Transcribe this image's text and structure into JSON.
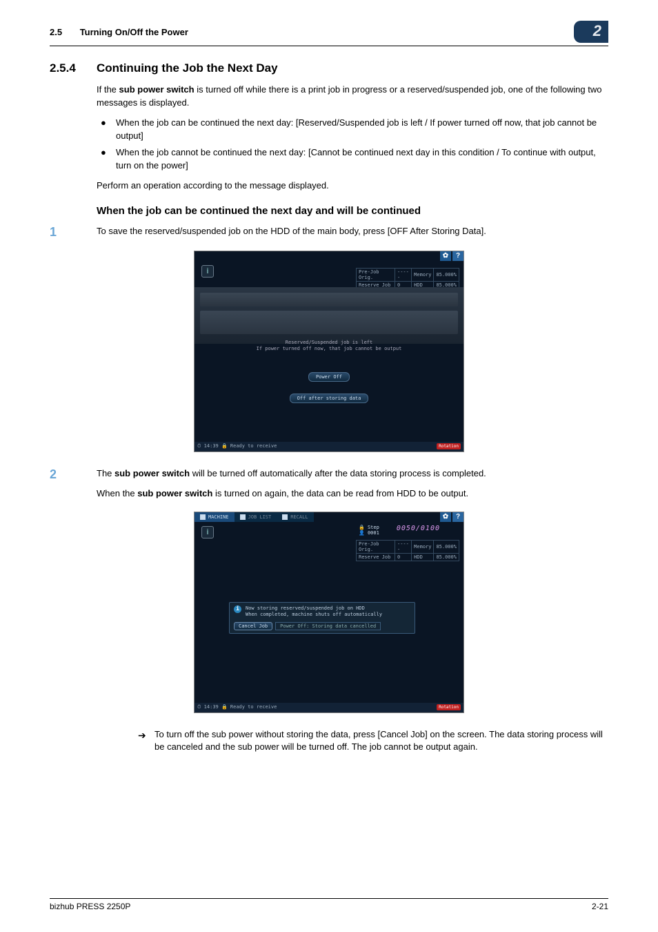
{
  "header": {
    "section_number": "2.5",
    "section_title": "Turning On/Off the Power",
    "chapter_badge": "2"
  },
  "section": {
    "number": "2.5.4",
    "title": "Continuing the Job the Next Day"
  },
  "intro": "If the sub power switch is turned off while there is a print job in progress or a reserved/suspended job, one of the following two messages is displayed.",
  "intro_bold": "sub power switch",
  "bullets": [
    "When the job can be continued the next day: [Reserved/Suspended job is left / If power turned off now, that job cannot be output]",
    "When the job cannot be continued the next day: [Cannot be continued next day in this condition / To continue with output, turn on the power]"
  ],
  "perform": "Perform an operation according to the message displayed.",
  "sub1_title": "When the job can be continued the next day and will be continued",
  "step1": {
    "num": "1",
    "text": "To save the reserved/suspended job on the HDD of the main body, press [OFF After Storing Data]."
  },
  "step2": {
    "num": "2",
    "line1_a": "The ",
    "line1_bold": "sub power switch",
    "line1_b": " will be turned off automatically after the data storing process is completed.",
    "line2_a": "When the ",
    "line2_bold": "sub power switch",
    "line2_b": " is turned on again, the data can be read from HDD to be output."
  },
  "arrow_note": "To turn off the sub power without storing the data, press [Cancel Job] on the screen. The data storing process will be canceled and the sub power will be turned off. The job cannot be output again.",
  "screenshot1": {
    "stats": {
      "r1c1": "Pre-Job Orig.",
      "r1c2": "-----",
      "r1c3": "Memory",
      "r1c4": "85.000%",
      "r2c1": "Reserve Job",
      "r2c2": "0",
      "r2c3": "HDD",
      "r2c4": "85.000%"
    },
    "msg_l1": "Reserved/Suspended job is left",
    "msg_l2": "If power turned off now, that job cannot be output",
    "btn1": "Power Off",
    "btn2": "Off after storing data",
    "footer_left": "⏱ 14:39  🔒 Ready to receive",
    "footer_right": "Rotation"
  },
  "screenshot2": {
    "tabs": {
      "t1": "MACHINE",
      "t2": "JOB LIST",
      "t3": "RECALL"
    },
    "step_label": "Step",
    "step_sub": "0001",
    "counter": "0050/0100",
    "stats": {
      "r1c1": "Pre-Job Orig.",
      "r1c2": "-----",
      "r1c3": "Memory",
      "r1c4": "85.000%",
      "r2c1": "Reserve Job",
      "r2c2": "0",
      "r2c3": "HDD",
      "r2c4": "85.000%"
    },
    "msg_l1": "Now storing reserved/suspended job on HDD",
    "msg_l2": "When completed, machine shuts off automatically",
    "cancel": "Cancel Job",
    "pwr": "Power Off: Storing data cancelled",
    "footer_left": "⏱ 14:39  🔒 Ready to receive",
    "footer_right": "Rotation"
  },
  "footer": {
    "left": "bizhub PRESS 2250P",
    "right": "2-21"
  }
}
